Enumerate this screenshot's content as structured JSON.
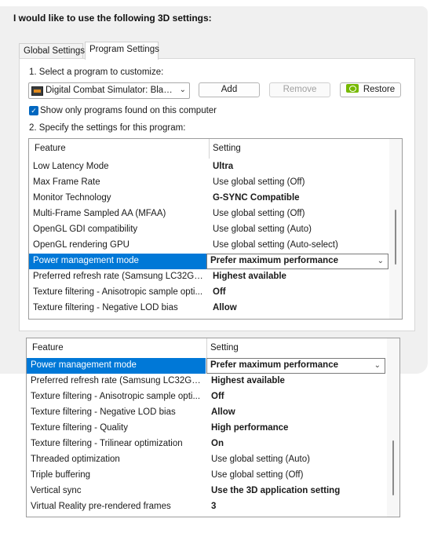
{
  "heading": "I would like to use the following 3D settings:",
  "tabs": [
    {
      "label": "Global Settings"
    },
    {
      "label": "Program Settings"
    }
  ],
  "step1": {
    "label": "1. Select a program to customize:",
    "program": "Digital Combat Simulator: Black ...",
    "add_label": "Add",
    "remove_label": "Remove",
    "restore_label": "Restore"
  },
  "show_only": {
    "label": "Show only programs found on this computer",
    "checked": true
  },
  "step2": {
    "label": "2. Specify the settings for this program:"
  },
  "grid1": {
    "col_feature": "Feature",
    "col_setting": "Setting",
    "rows": [
      {
        "feature": "Low Latency Mode",
        "setting": "Ultra",
        "bold": true
      },
      {
        "feature": "Max Frame Rate",
        "setting": "Use global setting (Off)",
        "bold": false
      },
      {
        "feature": "Monitor Technology",
        "setting": "G-SYNC Compatible",
        "bold": true
      },
      {
        "feature": "Multi-Frame Sampled AA (MFAA)",
        "setting": "Use global setting (Off)",
        "bold": false
      },
      {
        "feature": "OpenGL GDI compatibility",
        "setting": "Use global setting (Auto)",
        "bold": false
      },
      {
        "feature": "OpenGL rendering GPU",
        "setting": "Use global setting (Auto-select)",
        "bold": false
      },
      {
        "feature": "Power management mode",
        "setting": "Prefer maximum performance",
        "bold": true
      },
      {
        "feature": "Preferred refresh rate (Samsung LC32G7xT)",
        "setting": "Highest available",
        "bold": true
      },
      {
        "feature": "Texture filtering - Anisotropic sample opti...",
        "setting": "Off",
        "bold": true
      },
      {
        "feature": "Texture filtering - Negative LOD bias",
        "setting": "Allow",
        "bold": true
      }
    ]
  },
  "grid2": {
    "col_feature": "Feature",
    "col_setting": "Setting",
    "rows": [
      {
        "feature": "Power management mode",
        "setting": "Prefer maximum performance",
        "bold": true
      },
      {
        "feature": "Preferred refresh rate (Samsung LC32G7xT)",
        "setting": "Highest available",
        "bold": true
      },
      {
        "feature": "Texture filtering - Anisotropic sample opti...",
        "setting": "Off",
        "bold": true
      },
      {
        "feature": "Texture filtering - Negative LOD bias",
        "setting": "Allow",
        "bold": true
      },
      {
        "feature": "Texture filtering - Quality",
        "setting": "High performance",
        "bold": true
      },
      {
        "feature": "Texture filtering - Trilinear optimization",
        "setting": "On",
        "bold": true
      },
      {
        "feature": "Threaded optimization",
        "setting": "Use global setting (Auto)",
        "bold": false
      },
      {
        "feature": "Triple buffering",
        "setting": "Use global setting (Off)",
        "bold": false
      },
      {
        "feature": "Vertical sync",
        "setting": "Use the 3D application setting",
        "bold": true
      },
      {
        "feature": "Virtual Reality pre-rendered frames",
        "setting": "3",
        "bold": true
      }
    ]
  },
  "colors": {
    "selection": "#0078d7",
    "nvidia_green": "#76b900",
    "checkbox": "#0067c0"
  },
  "icons": {
    "program": "dcs-program-icon",
    "restore": "nvidia-icon",
    "dropdown": "chevron-down-icon",
    "check": "check-icon"
  }
}
